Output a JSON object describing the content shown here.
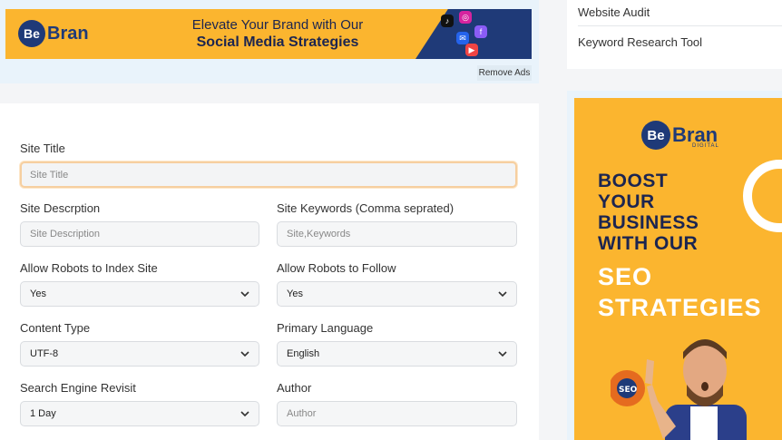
{
  "top_ad": {
    "logo_be": "Be",
    "logo_bran": "Bran",
    "headline_line1": "Elevate Your Brand with Our",
    "headline_line2": "Social Media Strategies",
    "remove_ads": "Remove Ads"
  },
  "right_links": {
    "items": [
      "Website Audit",
      "Keyword Research Tool"
    ]
  },
  "side_ad": {
    "logo_be": "Be",
    "logo_bran": "Bran",
    "logo_sub": "DIGITAL",
    "boost_lines": [
      "BOOST",
      "YOUR",
      "BUSINESS",
      "WITH OUR"
    ],
    "seo_lines": [
      "SEO",
      "STRATEGIES"
    ],
    "badge": "SEO"
  },
  "form": {
    "site_title": {
      "label": "Site Title",
      "placeholder": "Site Title"
    },
    "site_description": {
      "label": "Site Descrption",
      "placeholder": "Site Description"
    },
    "site_keywords": {
      "label": "Site Keywords (Comma seprated)",
      "placeholder": "Site,Keywords"
    },
    "allow_robots_index": {
      "label": "Allow Robots to Index Site",
      "value": "Yes"
    },
    "allow_robots_follow": {
      "label": "Allow Robots to Follow",
      "value": "Yes"
    },
    "content_type": {
      "label": "Content Type",
      "value": "UTF-8"
    },
    "primary_language": {
      "label": "Primary Language",
      "value": "English"
    },
    "search_engine_revisit": {
      "label": "Search Engine Revisit",
      "value": "1 Day"
    },
    "author": {
      "label": "Author",
      "placeholder": "Author"
    }
  },
  "colors": {
    "ad_yellow": "#fbb52f",
    "ad_navy": "#1f3a78",
    "focus_border": "#f6cfa0"
  }
}
